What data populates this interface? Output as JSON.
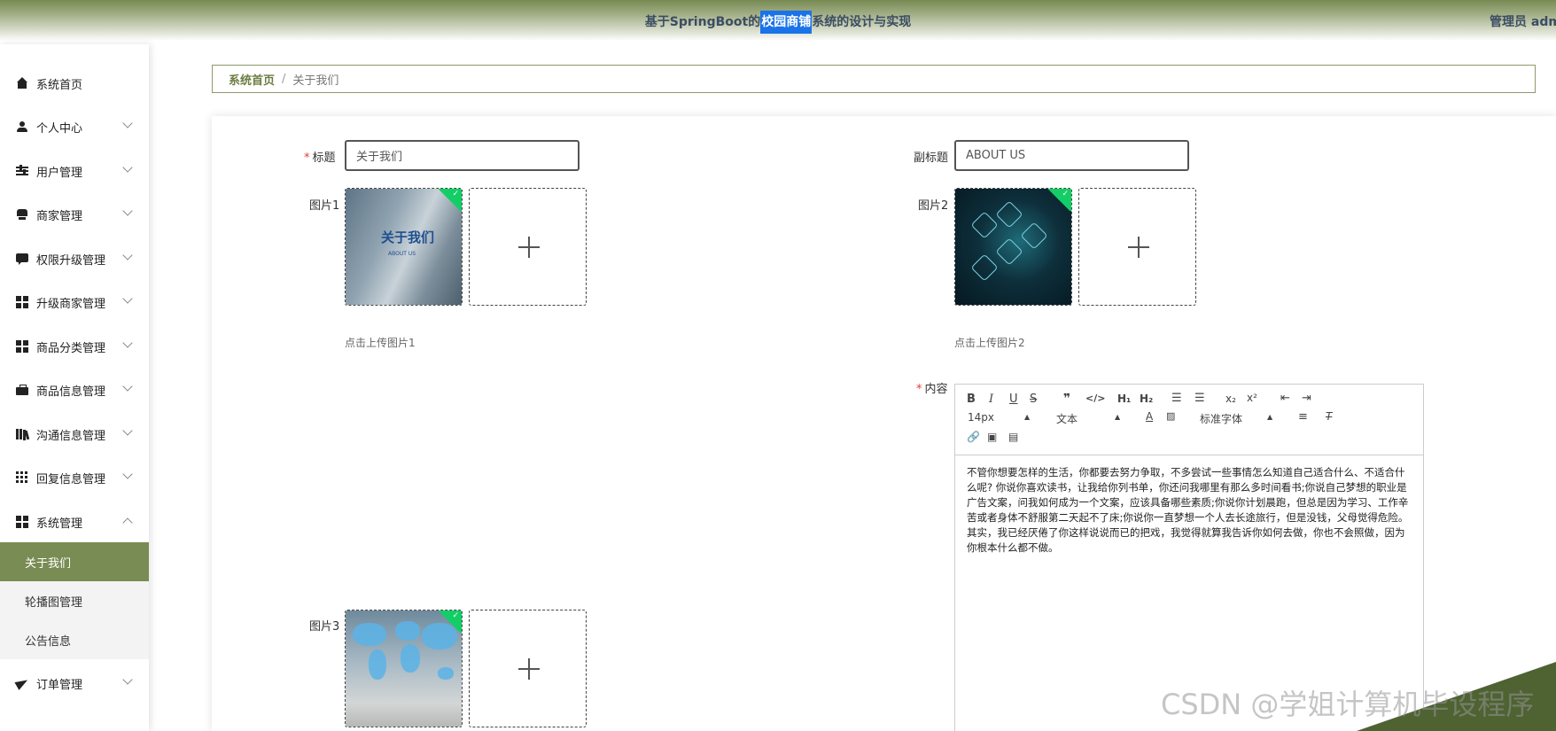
{
  "header": {
    "title_prefix": "基于SpringBoot的",
    "title_highlight": "校园商铺",
    "title_suffix": "系统的设计与实现",
    "admin_label": "管理员 adm"
  },
  "sidebar": {
    "items": [
      {
        "label": "系统首页",
        "icon": "home-icon"
      },
      {
        "label": "个人中心",
        "icon": "user-icon"
      },
      {
        "label": "用户管理",
        "icon": "sliders-icon"
      },
      {
        "label": "商家管理",
        "icon": "store-icon"
      },
      {
        "label": "权限升级管理",
        "icon": "chat-icon"
      },
      {
        "label": "升级商家管理",
        "icon": "grid-icon"
      },
      {
        "label": "商品分类管理",
        "icon": "grid-icon"
      },
      {
        "label": "商品信息管理",
        "icon": "briefcase-icon"
      },
      {
        "label": "沟通信息管理",
        "icon": "books-icon"
      },
      {
        "label": "回复信息管理",
        "icon": "dots-grid-icon"
      },
      {
        "label": "系统管理",
        "icon": "grid-icon"
      },
      {
        "label": "订单管理",
        "icon": "paper-plane-icon"
      }
    ],
    "sub_items": [
      {
        "label": "关于我们"
      },
      {
        "label": "轮播图管理"
      },
      {
        "label": "公告信息"
      }
    ]
  },
  "breadcrumb": {
    "home": "系统首页",
    "separator": "/",
    "current": "关于我们"
  },
  "form": {
    "required_mark": "*",
    "title_label": "标题",
    "title_value": "关于我们",
    "subtitle_label": "副标题",
    "subtitle_value": "ABOUT US",
    "image1_label": "图片1",
    "image2_label": "图片2",
    "image3_label": "图片3",
    "image1_hint": "点击上传图片1",
    "image2_hint": "点击上传图片2",
    "image1_text": "关于我们",
    "image1_subtext": "ABOUT US",
    "content_label": "内容"
  },
  "editor": {
    "font_size": "14px",
    "text_style": "文本",
    "font_family": "标准字体",
    "content": "不管你想要怎样的生活，你都要去努力争取，不多尝试一些事情怎么知道自己适合什么、不适合什么呢? 你说你喜欢读书，让我给你列书单，你还问我哪里有那么多时间看书;你说自己梦想的职业是广告文案，问我如何成为一个文案，应该具备哪些素质;你说你计划晨跑，但总是因为学习、工作辛苦或者身体不舒服第二天起不了床;你说你一直梦想一个人去长途旅行，但是没钱，父母觉得危险。其实，我已经厌倦了你这样说说而已的把戏，我觉得就算我告诉你如何去做，你也不会照做，因为你根本什么都不做。"
  },
  "watermark": "CSDN @学姐计算机毕设程序",
  "colors": {
    "accent": "#798c53",
    "required": "#e53935",
    "upload_success": "#13ce66",
    "highlight": "#1a73e8"
  }
}
